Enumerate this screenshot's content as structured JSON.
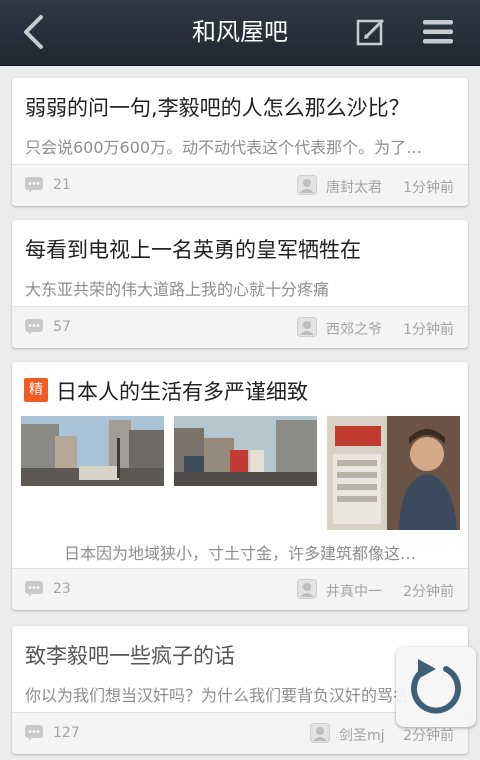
{
  "header": {
    "title": "和风屋吧"
  },
  "posts": [
    {
      "title": "弱弱的问一句,李毅吧的人怎么那么沙比？",
      "summary": "只会说600万600万。动不动代表这个代表那个。为了…",
      "comments": "21",
      "author": "唐封太君",
      "time": "1分钟前"
    },
    {
      "title": "每看到电视上一名英勇的皇军牺牲在",
      "summary": "大东亚共荣的伟大道路上我的心就十分疼痛",
      "comments": "57",
      "author": "西郊之爷",
      "time": "1分钟前"
    },
    {
      "badge": "精",
      "title": "日本人的生活有多严谨细致",
      "summary": "日本因为地域狭小，寸土寸金，许多建筑都像这…",
      "comments": "23",
      "author": "井真中一",
      "time": "2分钟前"
    },
    {
      "title": "致李毅吧一些疯子的话",
      "summary": "你以为我们想当汉奸吗？为什么我们要背负汉奸的骂名",
      "comments": "127",
      "author": "剑圣mj",
      "time": "2分钟前"
    }
  ],
  "icons": {
    "back": "back-arrow-icon",
    "edit": "edit-icon",
    "menu": "menu-icon",
    "comment": "comment-icon",
    "avatar": "avatar-icon",
    "refresh": "refresh-icon"
  },
  "colors": {
    "topbar": "#26303b",
    "badge": "#f15a22",
    "refresh": "#3f5f78"
  }
}
